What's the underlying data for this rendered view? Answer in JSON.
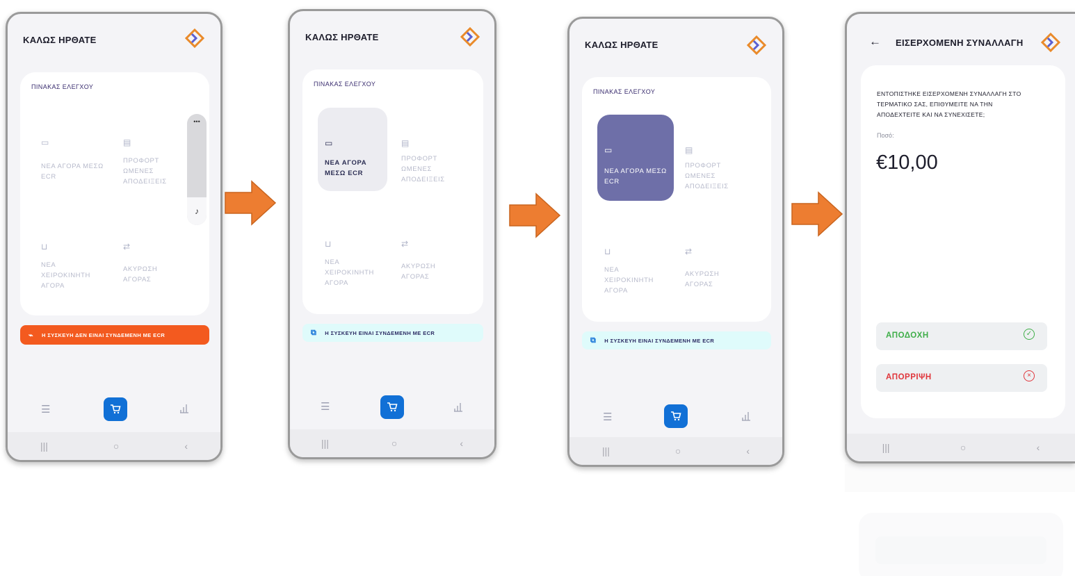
{
  "screens": [
    {
      "title": "ΚΑΛΩΣ ΗΡΘΑΤΕ",
      "panel_title": "ΠΙΝΑΚΑΣ ΕΛΕΓΧΟΥ",
      "tiles": [
        "ΝΕΑ ΑΓΟΡΑ ΜΕΣΩ ECR",
        "ΠΡΟΦΟΡΤ ΩΜΕΝΕΣ ΑΠΟΔΕΙΞΕΙΣ",
        "ΝΕΑ ΧΕΙΡΟΚΙΝΗΤΗ ΑΓΟΡΑ",
        "ΑΚΥΡΩΣΗ ΑΓΟΡΑΣ"
      ],
      "status": "Η ΣΥΣΚΕΥΗ ΔΕΝ ΕΙΝΑΙ ΣΥΝΔΕΜΕΝΗ ΜΕ ECR",
      "overlay_menu": "•••",
      "status_color": "#f35a1f"
    },
    {
      "title": "ΚΑΛΩΣ ΗΡΘΑΤΕ",
      "panel_title": "ΠΙΝΑΚΑΣ ΕΛΕΓΧΟΥ",
      "tiles": [
        "ΝΕΑ ΑΓΟΡΑ ΜΕΣΩ ECR",
        "ΠΡΟΦΟΡΤ ΩΜΕΝΕΣ ΑΠΟΔΕΙΞΕΙΣ",
        "ΝΕΑ ΧΕΙΡΟΚΙΝΗΤΗ ΑΓΟΡΑ",
        "ΑΚΥΡΩΣΗ ΑΓΟΡΑΣ"
      ],
      "status": "Η ΣΥΣΚΕΥΗ ΕΙΝΑΙ ΣΥΝΔΕΜΕΝΗ ΜΕ ECR",
      "status_color": "#dffbfb"
    },
    {
      "title": "ΚΑΛΩΣ ΗΡΘΑΤΕ",
      "panel_title": "ΠΙΝΑΚΑΣ ΕΛΕΓΧΟΥ",
      "tiles": [
        "ΝΕΑ ΑΓΟΡΑ ΜΕΣΩ ECR",
        "ΠΡΟΦΟΡΤ ΩΜΕΝΕΣ ΑΠΟΔΕΙΞΕΙΣ",
        "ΝΕΑ ΧΕΙΡΟΚΙΝΗΤΗ ΑΓΟΡΑ",
        "ΑΚΥΡΩΣΗ ΑΓΟΡΑΣ"
      ],
      "status": "Η ΣΥΣΚΕΥΗ ΕΙΝΑΙ ΣΥΝΔΕΜΕΝΗ ΜΕ ECR",
      "status_color": "#dffbfb"
    },
    {
      "back_icon": "←",
      "title": "ΕΙΣΕΡΧΟΜΕΝΗ ΣΥΝΑΛΛΑΓΗ",
      "message": "ΕΝΤΟΠΙΣΤΗΚΕ ΕΙΣΕΡΧΟΜΕΝΗ ΣΥΝΑΛΛΑΓΗ ΣΤΟ ΤΕΡΜΑΤΙΚΟ ΣΑΣ, ΕΠΙΘΥΜΕΙΤΕ ΝΑ ΤΗΝ ΑΠΟΔΕΧΤΕΙΤΕ ΚΑΙ ΝΑ ΣΥΝΕΧΙΣΕΤΕ;",
      "amount_label": "Ποσό:",
      "amount": "€10,00",
      "accept_label": "ΑΠΟΔΟΧΗ",
      "reject_label": "ΑΠΟΡΡΙΨΗ",
      "accept_color": "#3fae49",
      "reject_color": "#e0363c"
    }
  ],
  "sysbar": {
    "recent": "|||",
    "home": "○",
    "back": "‹"
  },
  "nav": {
    "menu": "☰",
    "cart": "🛒",
    "stats": "📶"
  },
  "arrow_color": "#ed7d31",
  "icons": [
    "devices-icon",
    "receipt-icon",
    "cart-icon",
    "refresh-icon"
  ]
}
